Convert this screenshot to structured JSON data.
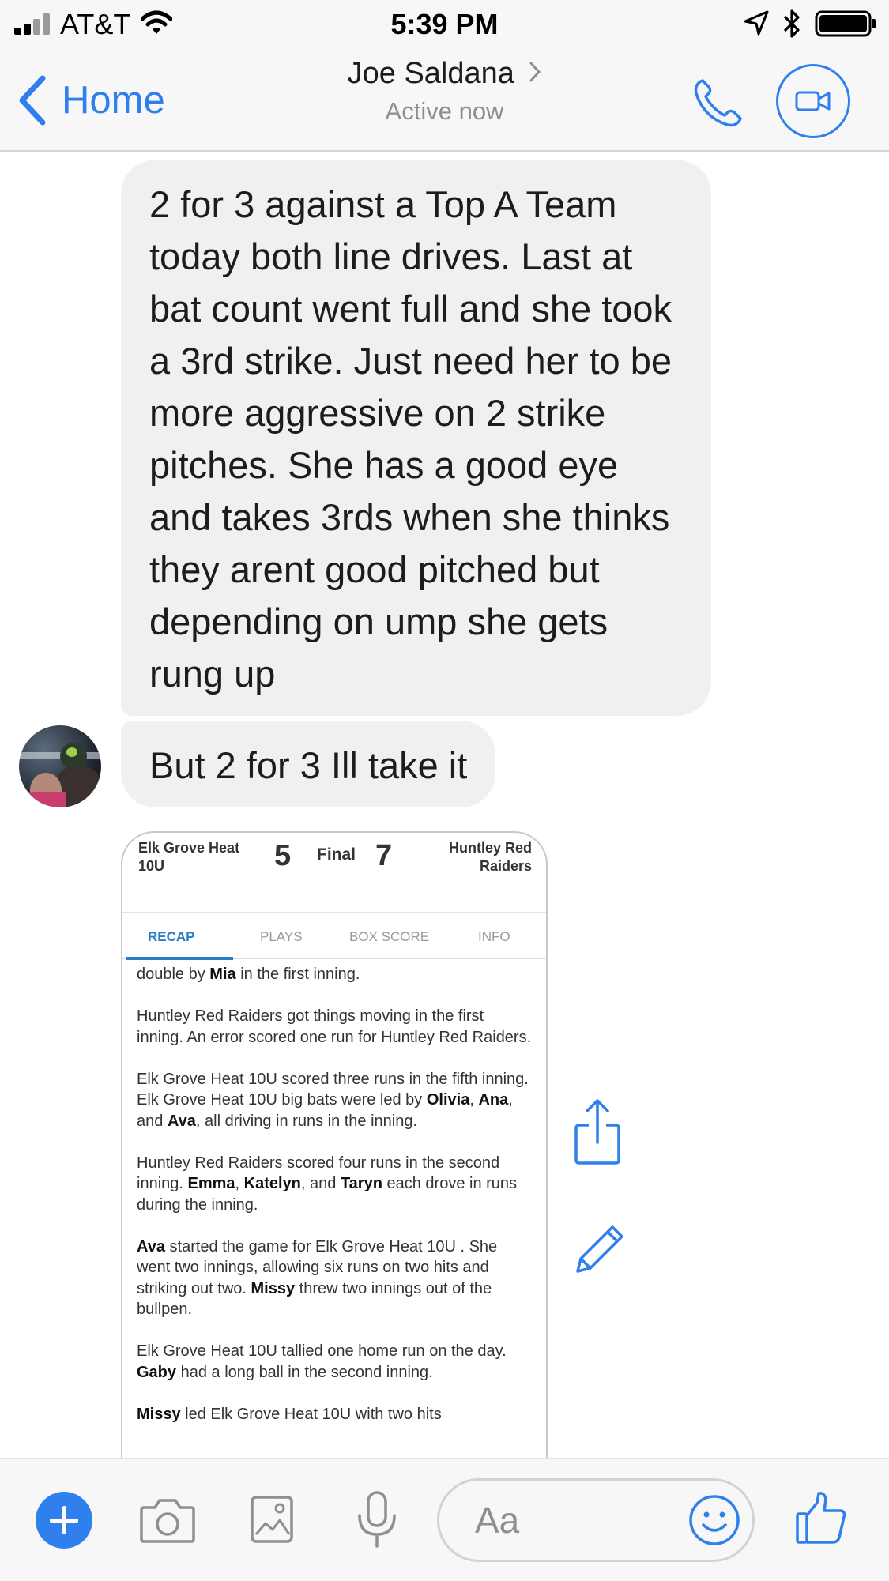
{
  "status_bar": {
    "carrier": "AT&T",
    "time": "5:39 PM"
  },
  "header": {
    "back_label": "Home",
    "contact_name": "Joe Saldana",
    "presence": "Active now"
  },
  "messages": [
    {
      "text": "2 for 3 against a Top A Team today both line drives. Last at bat count went full and she took a 3rd strike. Just need her to be more aggressive on 2 strike pitches. She has a good eye and takes 3rds when she thinks they arent good pitched but depending on ump she gets rung up"
    },
    {
      "text": "But 2 for 3 Ill take it"
    }
  ],
  "attachment": {
    "home_team": "Elk Grove Heat 10U",
    "home_score": "5",
    "status": "Final",
    "away_score": "7",
    "away_team": "Huntley Red Raiders",
    "tabs": [
      "RECAP",
      "PLAYS",
      "BOX SCORE",
      "INFO"
    ],
    "active_tab": "RECAP",
    "recap": {
      "p0": {
        "a": "double by ",
        "b": "Mia",
        "c": " in the first inning."
      },
      "p1": "Huntley Red Raiders got things moving in the first inning.  An error scored one run for Huntley Red Raiders.",
      "p2": {
        "a": "Elk Grove Heat 10U  scored three runs in the fifth inning.  Elk Grove Heat 10U  big bats were led by ",
        "b": "Olivia",
        "c": ", ",
        "d": "Ana",
        "e": ", and ",
        "f": "Ava",
        "g": ", all driving in runs in the inning."
      },
      "p3": {
        "a": "Huntley Red Raiders scored four runs in the second inning.  ",
        "b": "Emma",
        "c": ", ",
        "d": "Katelyn",
        "e": ", and ",
        "f": "Taryn",
        "g": " each drove in runs during the inning."
      },
      "p4": {
        "a": "Ava",
        "b": " started the game for Elk Grove Heat 10U . She went two innings, allowing six runs on two hits and striking out two.  ",
        "c": "Missy",
        "d": " threw two innings out of the bullpen."
      },
      "p5": {
        "a": "Elk Grove Heat 10U  tallied one home run on the day. ",
        "b": "Gaby",
        "c": " had a long ball in the second inning."
      },
      "p6": {
        "a": "Missy",
        "b": " led Elk Grove Heat 10U  with two hits"
      }
    }
  },
  "composer": {
    "placeholder": "Aa"
  },
  "icons": {
    "back": "chevron-left-icon",
    "call": "phone-icon",
    "video": "video-camera-icon",
    "share": "share-icon",
    "edit": "pencil-icon",
    "plus": "plus-icon",
    "camera": "camera-icon",
    "gallery": "image-icon",
    "mic": "microphone-icon",
    "emoji": "smiley-icon",
    "like": "thumbs-up-icon"
  },
  "colors": {
    "accent": "#2f80ed",
    "bubble": "#f0f0f0",
    "recap_tab": "#2a7cc7"
  }
}
